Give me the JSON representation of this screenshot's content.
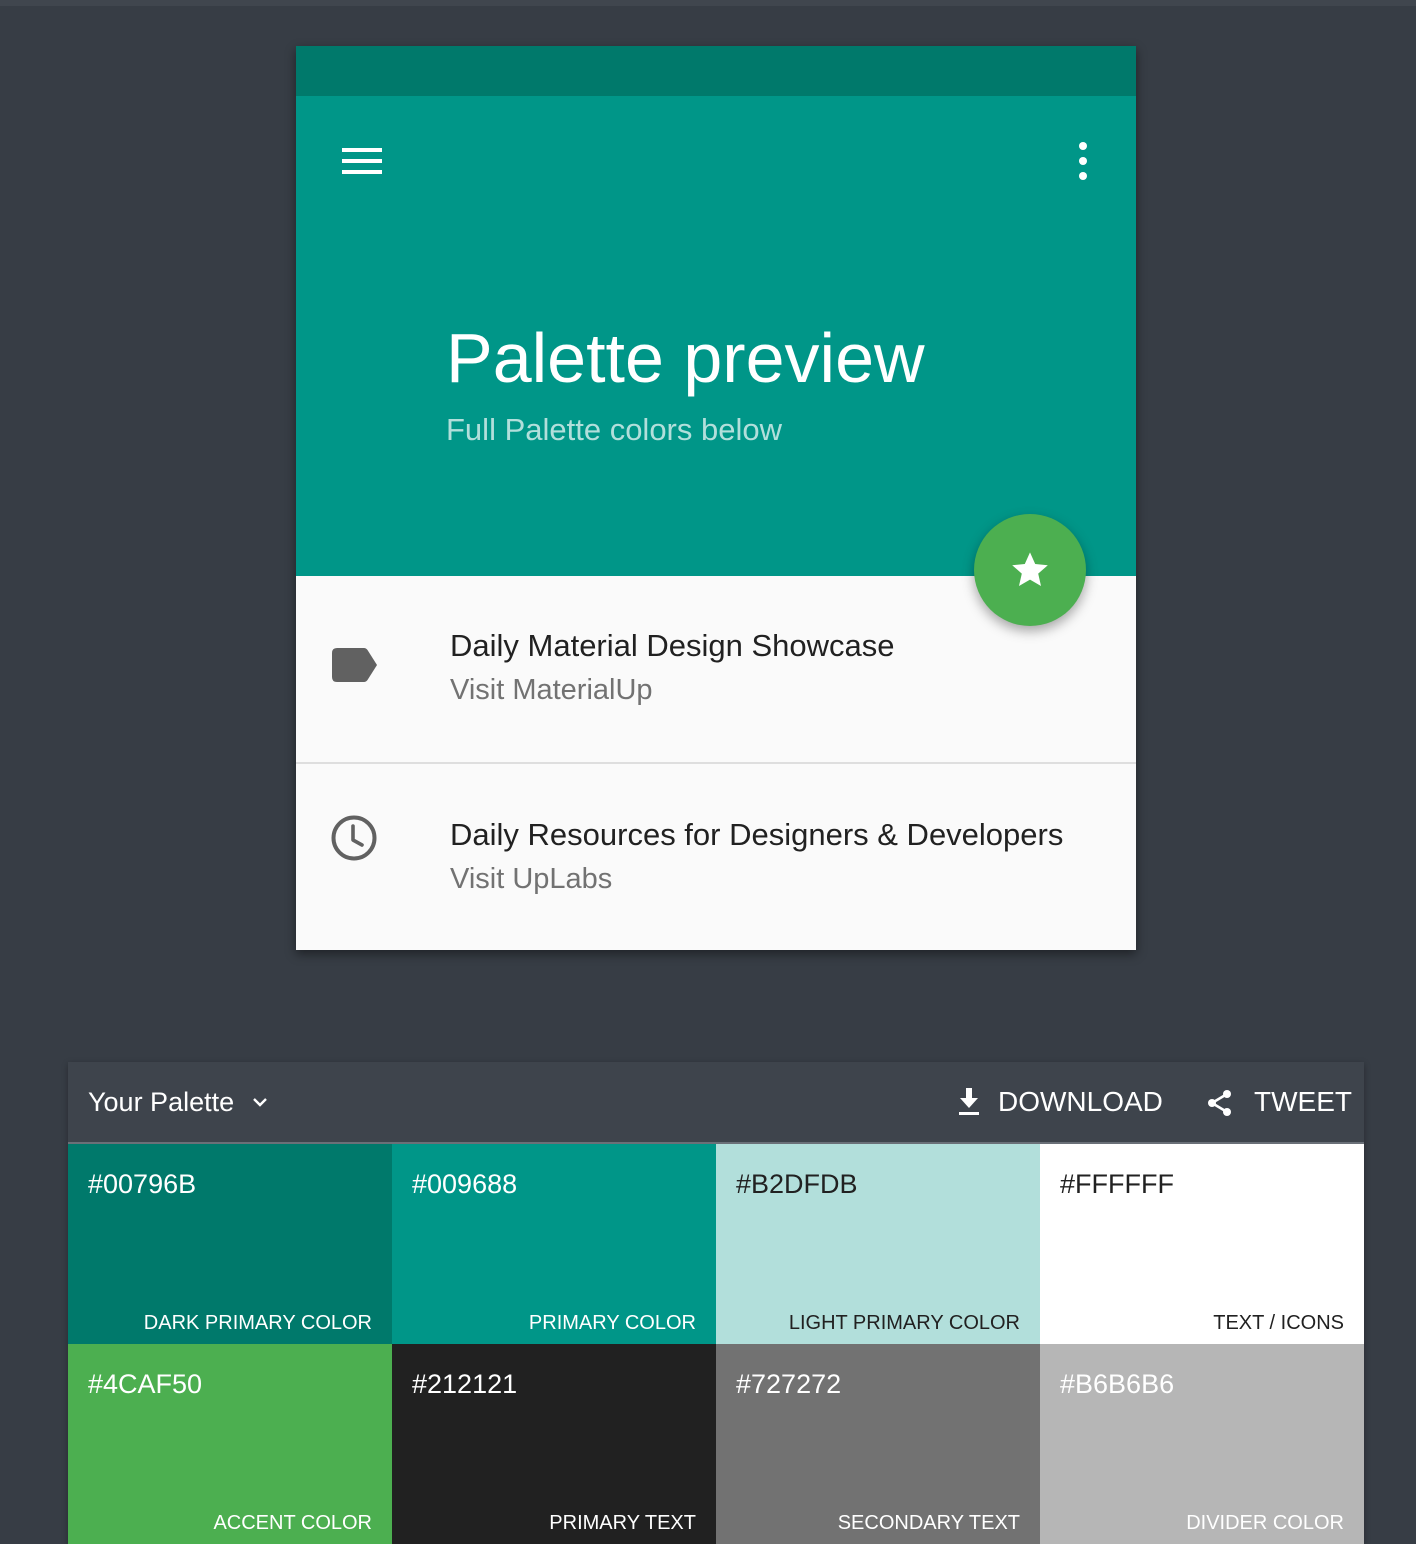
{
  "preview": {
    "title": "Palette preview",
    "subtitle": "Full Palette colors below",
    "items": [
      {
        "title": "Daily Material Design Showcase",
        "subtitle": "Visit MaterialUp",
        "icon": "label-icon"
      },
      {
        "title": "Daily Resources for Designers & Developers",
        "subtitle": "Visit UpLabs",
        "icon": "clock-icon"
      }
    ],
    "fab_icon": "star-icon"
  },
  "palette": {
    "select_label": "Your Palette",
    "download_label": "DOWNLOAD",
    "tweet_label": "TWEET",
    "swatches": [
      {
        "hex": "#00796B",
        "name": "DARK PRIMARY COLOR",
        "bg": "#00796B",
        "fg": "#ffffff"
      },
      {
        "hex": "#009688",
        "name": "PRIMARY COLOR",
        "bg": "#009688",
        "fg": "#ffffff"
      },
      {
        "hex": "#B2DFDB",
        "name": "LIGHT PRIMARY COLOR",
        "bg": "#B2DFDB",
        "fg": "#212121"
      },
      {
        "hex": "#FFFFFF",
        "name": "TEXT / ICONS",
        "bg": "#FFFFFF",
        "fg": "#212121"
      },
      {
        "hex": "#4CAF50",
        "name": "ACCENT COLOR",
        "bg": "#4CAF50",
        "fg": "#ffffff"
      },
      {
        "hex": "#212121",
        "name": "PRIMARY TEXT",
        "bg": "#212121",
        "fg": "#ffffff"
      },
      {
        "hex": "#727272",
        "name": "SECONDARY TEXT",
        "bg": "#727272",
        "fg": "#ffffff"
      },
      {
        "hex": "#B6B6B6",
        "name": "DIVIDER COLOR",
        "bg": "#B6B6B6",
        "fg": "#ffffff"
      }
    ]
  },
  "colors": {
    "page_background": "#373d45",
    "dark_primary": "#00796B",
    "primary": "#009688",
    "light_primary": "#B2DFDB",
    "accent": "#4CAF50",
    "primary_text": "#212121",
    "secondary_text": "#727272"
  }
}
